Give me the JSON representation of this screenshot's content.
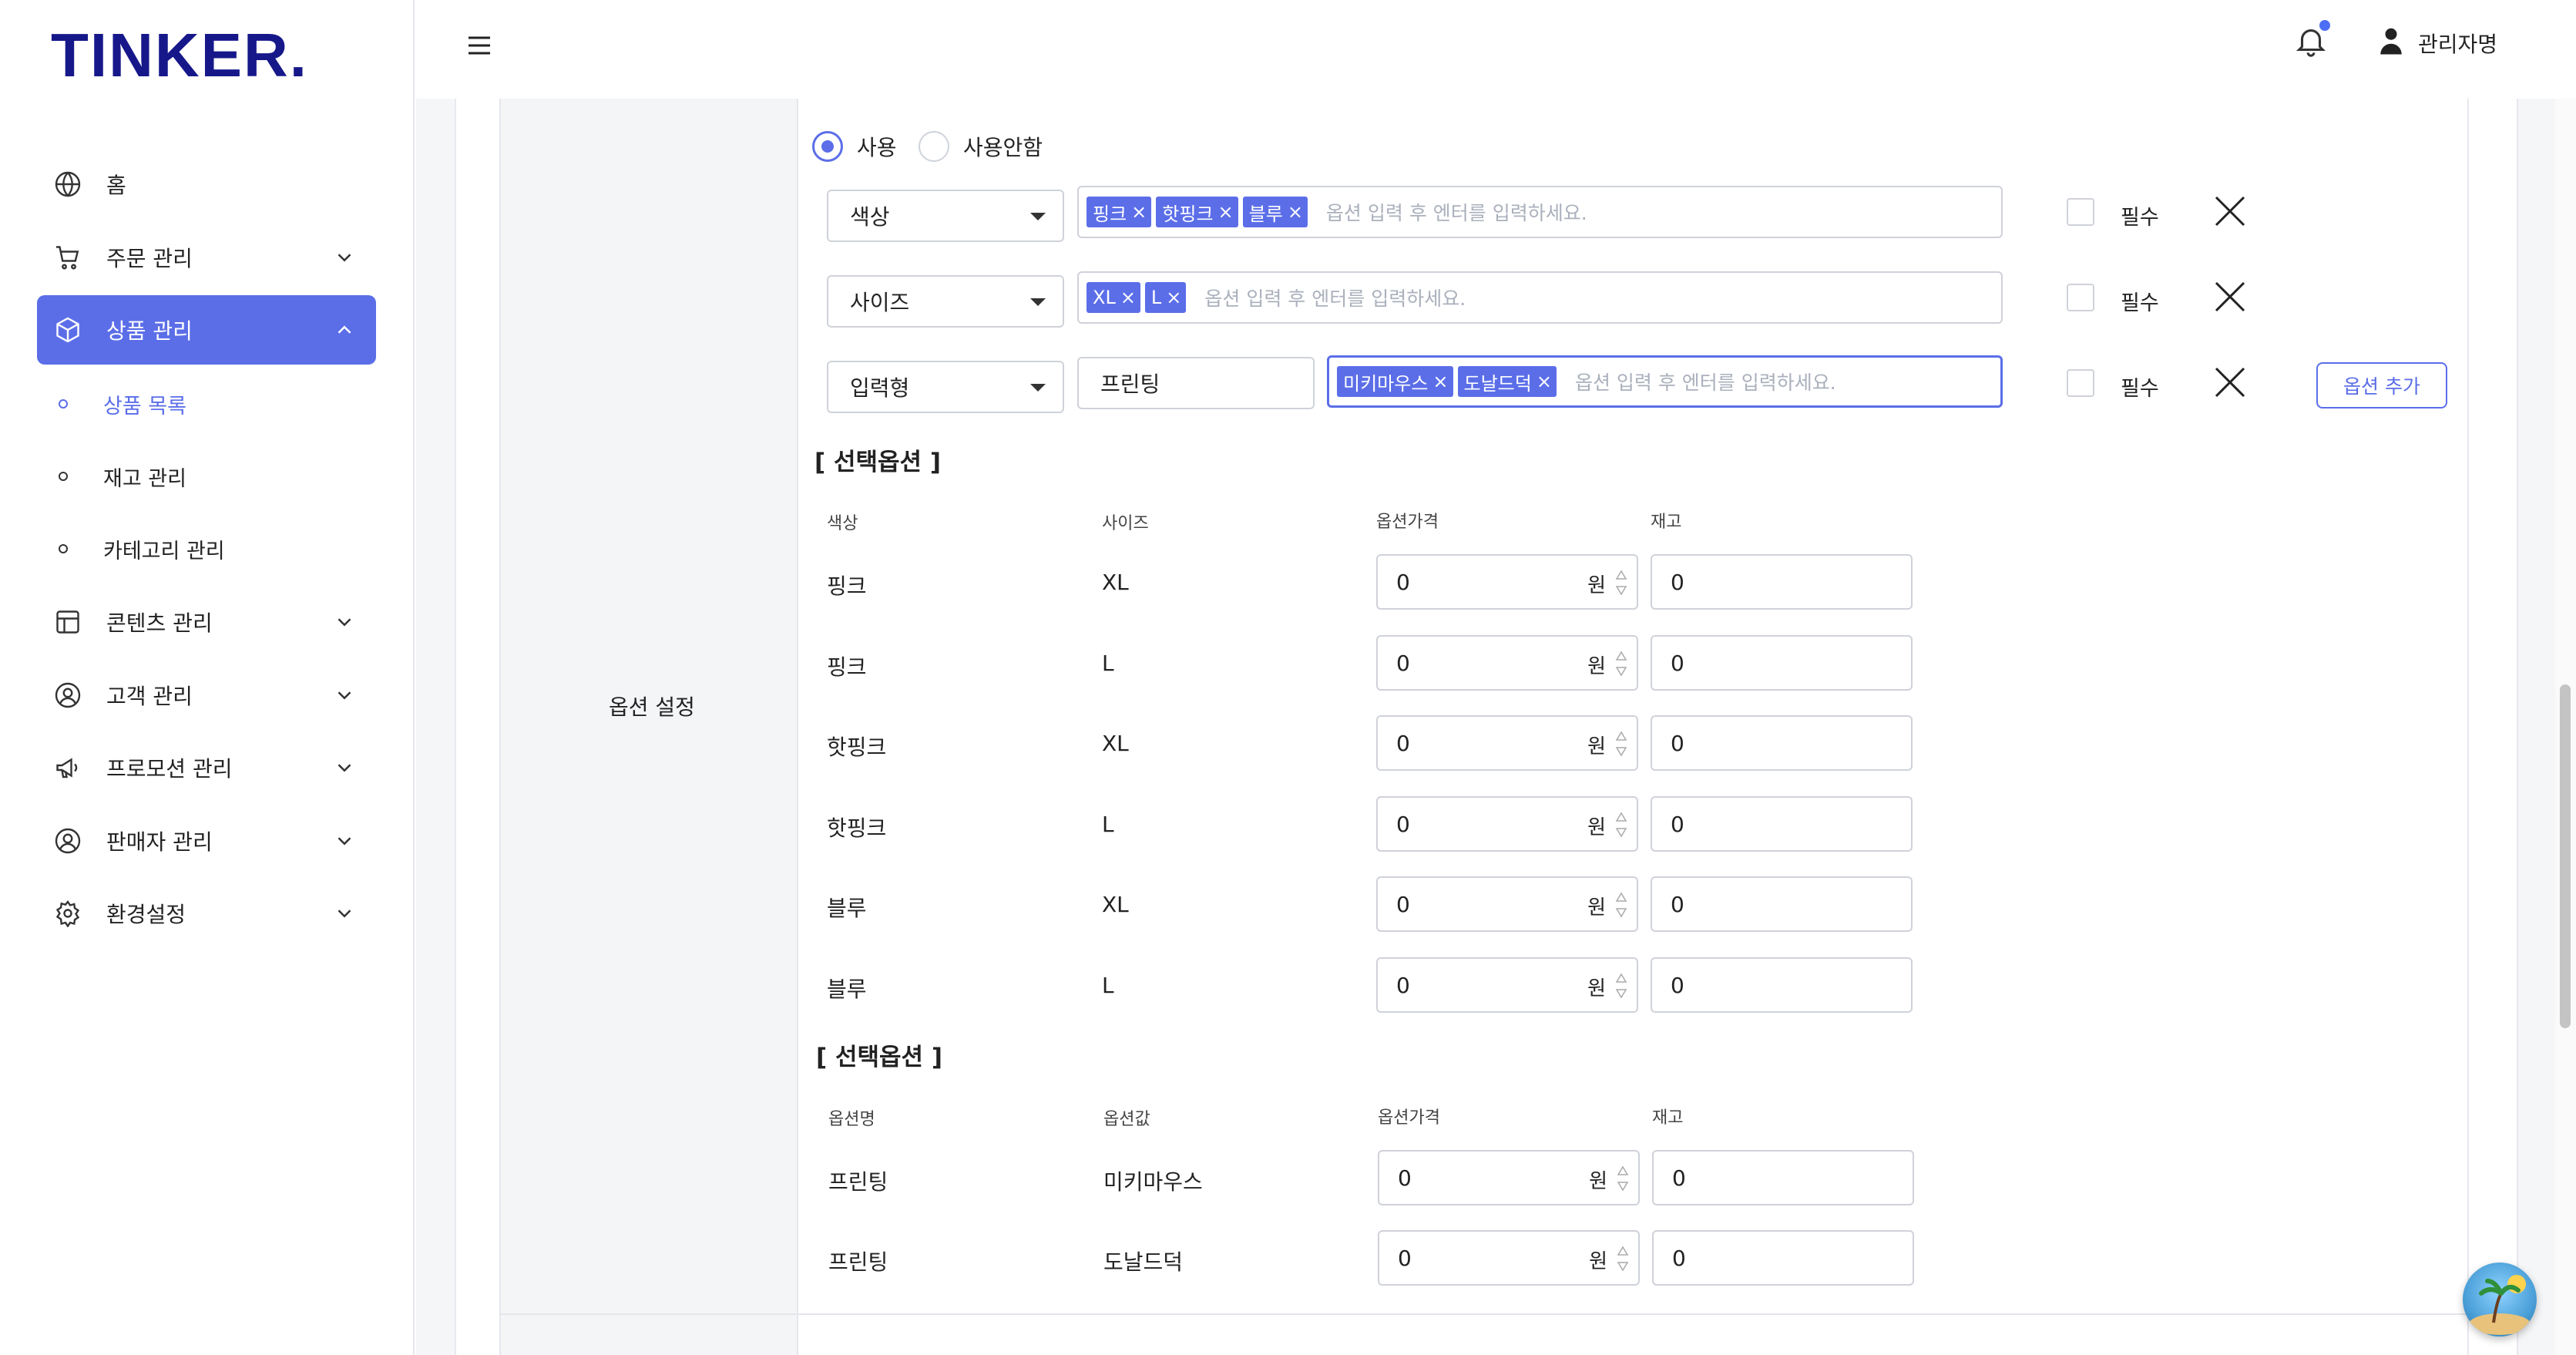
{
  "brand": {
    "logo": "TINKER."
  },
  "header": {
    "user_name": "관리자명"
  },
  "sidebar": {
    "items": [
      {
        "label": "홈"
      },
      {
        "label": "주문 관리"
      },
      {
        "label": "상품 관리"
      },
      {
        "label": "콘텐츠 관리"
      },
      {
        "label": "고객 관리"
      },
      {
        "label": "프로모션 관리"
      },
      {
        "label": "판매자 관리"
      },
      {
        "label": "환경설정"
      }
    ],
    "sub_items": [
      {
        "label": "상품 목록"
      },
      {
        "label": "재고 관리"
      },
      {
        "label": "카테고리 관리"
      }
    ]
  },
  "option_section": {
    "label": "옵션 설정",
    "radio_use": "사용",
    "radio_nouse": "사용안함",
    "placeholder": "옵션 입력 후 엔터를 입력하세요.",
    "required_label": "필수",
    "add_button": "옵션 추가",
    "rows": [
      {
        "type": "색상",
        "tags": [
          "핑크",
          "핫핑크",
          "블루"
        ]
      },
      {
        "type": "사이즈",
        "tags": [
          "XL",
          "L"
        ]
      },
      {
        "type": "입력형",
        "name": "프린팅",
        "tags": [
          "미키마우스",
          "도날드덕"
        ]
      }
    ]
  },
  "table1": {
    "title": "[ 선택옵션 ]",
    "headers": [
      "색상",
      "사이즈",
      "옵션가격",
      "재고"
    ],
    "unit": "원",
    "rows": [
      {
        "c1": "핑크",
        "c2": "XL",
        "price": "0",
        "stock": "0"
      },
      {
        "c1": "핑크",
        "c2": "L",
        "price": "0",
        "stock": "0"
      },
      {
        "c1": "핫핑크",
        "c2": "XL",
        "price": "0",
        "stock": "0"
      },
      {
        "c1": "핫핑크",
        "c2": "L",
        "price": "0",
        "stock": "0"
      },
      {
        "c1": "블루",
        "c2": "XL",
        "price": "0",
        "stock": "0"
      },
      {
        "c1": "블루",
        "c2": "L",
        "price": "0",
        "stock": "0"
      }
    ]
  },
  "table2": {
    "title": "[ 선택옵션 ]",
    "headers": [
      "옵션명",
      "옵션값",
      "옵션가격",
      "재고"
    ],
    "unit": "원",
    "rows": [
      {
        "c1": "프린팅",
        "c2": "미키마우스",
        "price": "0",
        "stock": "0"
      },
      {
        "c1": "프린팅",
        "c2": "도날드덕",
        "price": "0",
        "stock": "0"
      }
    ]
  },
  "icons": {
    "home": "globe-icon",
    "order": "cart-icon",
    "product": "box-icon",
    "content": "grid-icon",
    "customer": "user-circle-icon",
    "promotion": "megaphone-icon",
    "seller": "user-circle-icon",
    "settings": "gear-icon"
  },
  "colors": {
    "accent": "#5b6ee8",
    "brand": "#16188a"
  }
}
